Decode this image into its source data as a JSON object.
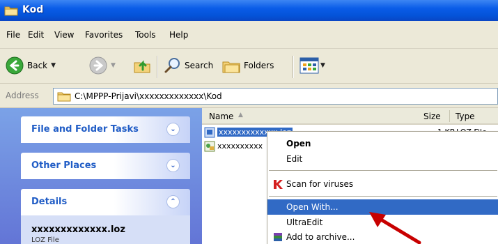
{
  "window": {
    "title": "Kod"
  },
  "menu": [
    "File",
    "Edit",
    "View",
    "Favorites",
    "Tools",
    "Help"
  ],
  "toolbar": {
    "back_label": "Back",
    "search_label": "Search",
    "folders_label": "Folders"
  },
  "address": {
    "label": "Address",
    "path": "C:\\MPPP-Prijavi\\xxxxxxxxxxxxx\\Kod"
  },
  "left_pane": {
    "panels": [
      {
        "title": "File and Folder Tasks"
      },
      {
        "title": "Other Places"
      },
      {
        "title": "Details"
      }
    ],
    "details": {
      "file_name": "xxxxxxxxxxxxx.loz",
      "file_type": "LOZ File"
    }
  },
  "file_list": {
    "columns": {
      "name": "Name",
      "size": "Size",
      "type": "Type"
    },
    "rows": [
      {
        "name": "xxxxxxxxxxxxx.loz",
        "size": "1 KB",
        "type": "LOZ File",
        "selected": true
      },
      {
        "name": "xxxxxxxxxx",
        "size": "",
        "type": ""
      }
    ]
  },
  "context_menu": {
    "items": [
      "Open",
      "Edit",
      "Scan for viruses",
      "Open With...",
      "UltraEdit",
      "Add to archive..."
    ],
    "highlighted": "Open With..."
  },
  "colors": {
    "titlebar": "#0a5ce8",
    "selection": "#316ac5",
    "left_pane": "#6f8ee0",
    "annotation_arrow": "#c80000"
  }
}
